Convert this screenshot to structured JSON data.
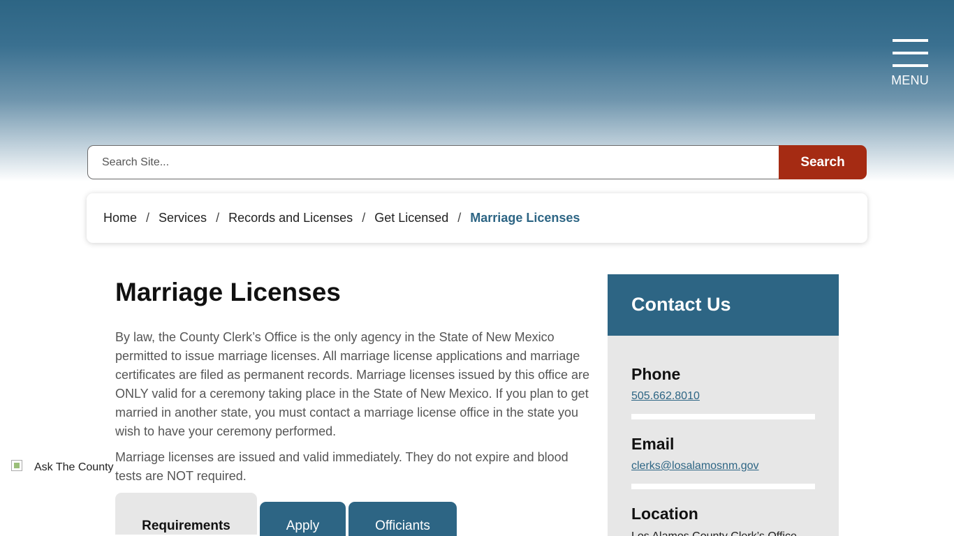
{
  "header": {
    "menu_label": "MENU"
  },
  "search": {
    "placeholder": "Search Site...",
    "button_label": "Search",
    "accent_color": "#a52b13"
  },
  "breadcrumb": {
    "items": [
      "Home",
      "Services",
      "Records and Licenses",
      "Get Licensed"
    ],
    "separator": "/",
    "current": "Marriage Licenses"
  },
  "main": {
    "title": "Marriage Licenses",
    "paragraphs": [
      "By law, the County Clerk’s Office is the only agency in the State of New Mexico permitted to issue marriage licenses. All marriage license applications and marriage certificates are filed as permanent records. Marriage licenses issued by this office are ONLY valid for a ceremony taking place in the State of New Mexico. If you plan to get married in another state, you must contact a marriage license office in the state you wish to have your ceremony performed.",
      "Marriage licenses are issued and valid immediately. They do not expire and blood tests are NOT required."
    ],
    "tabs": [
      {
        "label": "Requirements",
        "active": true
      },
      {
        "label": "Apply",
        "active": false
      },
      {
        "label": "Officiants",
        "active": false
      }
    ]
  },
  "contact": {
    "title": "Contact Us",
    "phone_label": "Phone",
    "phone": "505.662.8010",
    "email_label": "Email",
    "email": "clerks@losalamosnm.gov",
    "location_label": "Location",
    "location_text": "Los Alamos County Clerk’s Office"
  },
  "ask": {
    "label": "Ask The County"
  },
  "colors": {
    "brand": "#2d6584",
    "panel": "#e7e7e7"
  }
}
